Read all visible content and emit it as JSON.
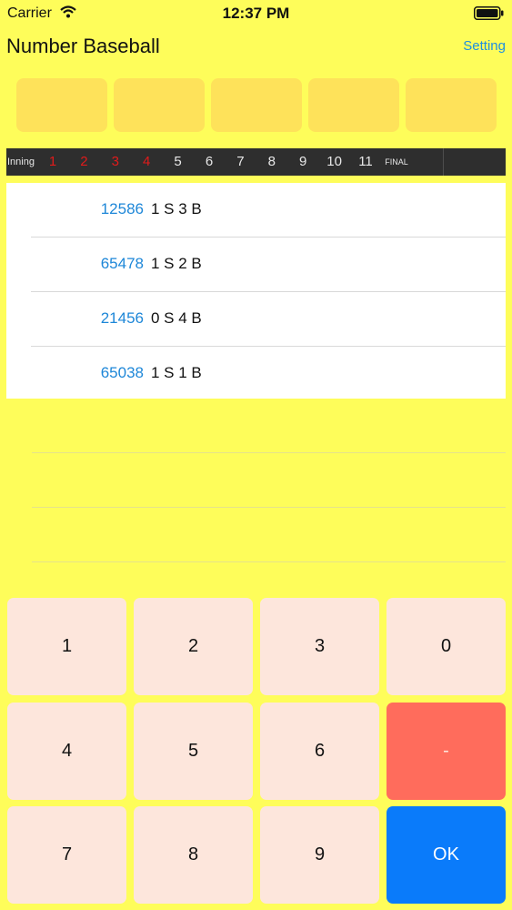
{
  "status": {
    "carrier": "Carrier",
    "time": "12:37 PM"
  },
  "header": {
    "title": "Number Baseball",
    "setting_label": "Setting"
  },
  "innings": {
    "label": "Inning",
    "numbers": [
      "1",
      "2",
      "3",
      "4",
      "5",
      "6",
      "7",
      "8",
      "9",
      "10",
      "11"
    ],
    "played_count": 4,
    "final_label": "FINAL"
  },
  "history": [
    {
      "guess": "12586",
      "result": "1 S 3 B"
    },
    {
      "guess": "65478",
      "result": "1 S 2 B"
    },
    {
      "guess": "21456",
      "result": "0 S 4 B"
    },
    {
      "guess": "65038",
      "result": "1 S 1 B"
    }
  ],
  "keypad": {
    "k1": "1",
    "k2": "2",
    "k3": "3",
    "k0": "0",
    "k4": "4",
    "k5": "5",
    "k6": "6",
    "delete": "-",
    "k7": "7",
    "k8": "8",
    "k9": "9",
    "ok": "OK"
  },
  "colors": {
    "background": "#fefd5a",
    "slot": "#fee25a",
    "guess_text": "#1e87d8",
    "played_inning": "#e01b1b",
    "delete_key": "#ff6c5c",
    "ok_key": "#0a7bfa"
  },
  "icons": {
    "wifi": "wifi-icon",
    "battery": "battery-icon"
  }
}
